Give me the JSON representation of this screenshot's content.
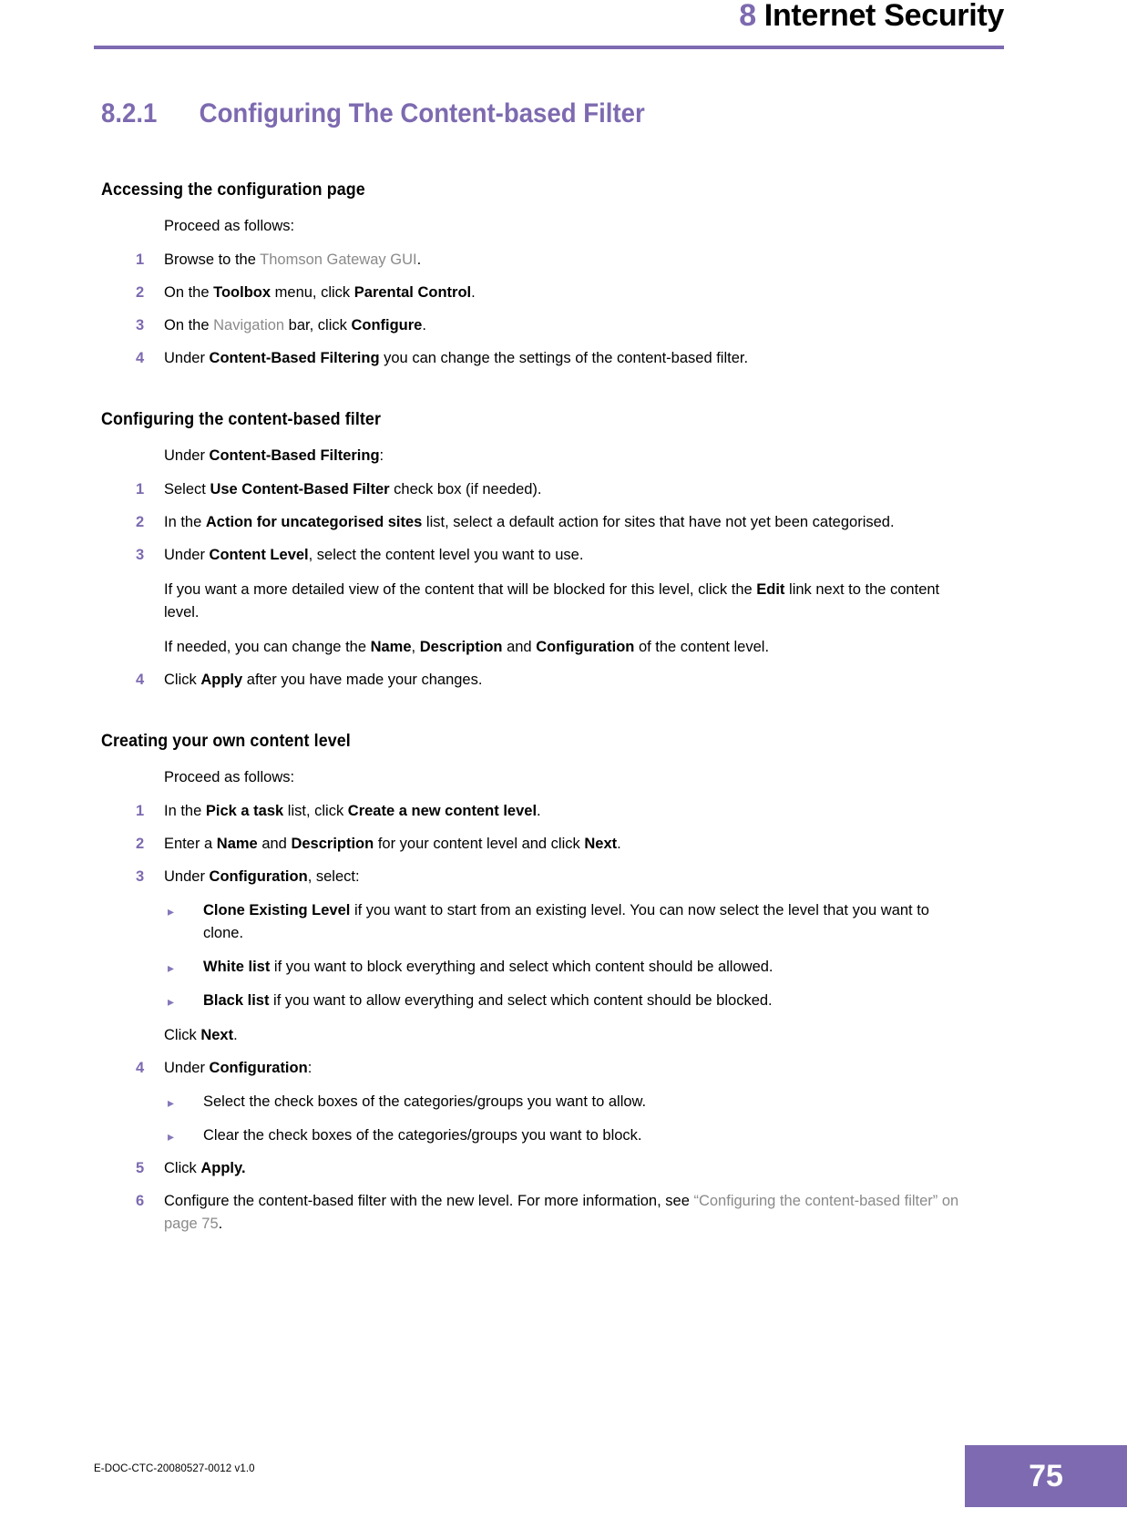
{
  "header": {
    "chapter_number": "8",
    "chapter_title": "Internet Security",
    "rule_color": "#7d6ab0"
  },
  "section": {
    "number": "8.2.1",
    "title": "Configuring The Content-based Filter",
    "color": "#7d6ab0"
  },
  "blocks": [
    {
      "heading": "Accessing the configuration page",
      "intro": "Proceed as follows:",
      "items": [
        {
          "marker": "1",
          "text": "Browse to the Thomson Gateway GUI."
        },
        {
          "marker": "2",
          "text": "On the Toolbox menu, click Parental Control."
        },
        {
          "marker": "3",
          "text": "On the Navigation bar, click Configure."
        },
        {
          "marker": "4",
          "text": "Under Content-Based Filtering you can change the settings of the content-based filter."
        }
      ]
    },
    {
      "heading": "Configuring the content-based filter",
      "intro": "Under Content-Based Filtering:",
      "items": [
        {
          "marker": "1",
          "text": "Select Use Content-Based Filter check box (if needed)."
        },
        {
          "marker": "2",
          "text": "In the Action for uncategorised sites list, select a default action for sites that have not yet been categorised."
        },
        {
          "marker": "3",
          "text": "Under Content Level, select the content level you want to use.",
          "paragraphs": [
            "If you want a more detailed view of the content that will be blocked for this level, click the Edit link next to the content level.",
            "If needed, you can change the Name, Description and Configuration of the content level."
          ]
        },
        {
          "marker": "4",
          "text": "Click Apply after you have made your changes."
        }
      ]
    },
    {
      "heading": "Creating your own content level",
      "intro": "Proceed as follows:",
      "items": [
        {
          "marker": "1",
          "text": "In the Pick a task list, click Create a new content level."
        },
        {
          "marker": "2",
          "text": "Enter a Name and Description for your content level and click Next."
        },
        {
          "marker": "3",
          "text": "Under Configuration, select:",
          "bullets": [
            "Clone Existing Level if you want to start from an existing level. You can now select the level that you want to clone.",
            "White list if you want to block everything and select which content should be allowed.",
            "Black list if you want to allow everything and select which content should be blocked."
          ],
          "after": "Click Next."
        },
        {
          "marker": "4",
          "text": "Under Configuration:",
          "bullets": [
            "Select the check boxes of the categories/groups you want to allow.",
            "Clear the check boxes of the categories/groups you want to block."
          ]
        },
        {
          "marker": "5",
          "text": "Click Apply."
        },
        {
          "marker": "6",
          "text": "Configure the content-based filter with the new level. For more information, see “Configuring the content-based filter” on page 75."
        }
      ]
    }
  ],
  "bullet_glyph": "▸",
  "footer": {
    "doc_id": "E-DOC-CTC-20080527-0012 v1.0",
    "page_number": "75",
    "page_box_color": "#7d6ab0"
  },
  "b1_h": "Accessing the configuration page",
  "b1_intro": "Proceed as follows:",
  "b1_i1_n": "1",
  "b1_i1_a": "Browse to the ",
  "b1_i1_x": "Thomson Gateway GUI",
  "b1_i1_b": ".",
  "b1_i2_n": "2",
  "b1_i2_a": "On the ",
  "b1_i2_b": "Toolbox",
  "b1_i2_c": " menu, click ",
  "b1_i2_d": "Parental Control",
  "b1_i2_e": ".",
  "b1_i3_n": "3",
  "b1_i3_a": "On the ",
  "b1_i3_x": "Navigation",
  "b1_i3_b": " bar, click ",
  "b1_i3_c": "Configure",
  "b1_i3_d": ".",
  "b1_i4_n": "4",
  "b1_i4_a": "Under ",
  "b1_i4_b": "Content-Based Filtering",
  "b1_i4_c": " you can change the settings of the content-based filter.",
  "b2_h": "Configuring the content-based filter",
  "b2_intro_a": "Under ",
  "b2_intro_b": "Content-Based Filtering",
  "b2_intro_c": ":",
  "b2_i1_n": "1",
  "b2_i1_a": "Select ",
  "b2_i1_b": "Use Content-Based Filter",
  "b2_i1_c": " check box (if needed).",
  "b2_i2_n": "2",
  "b2_i2_a": "In the ",
  "b2_i2_b": "Action for uncategorised sites",
  "b2_i2_c": " list, select a default action for sites that have not yet been categorised.",
  "b2_i3_n": "3",
  "b2_i3_a": "Under ",
  "b2_i3_b": "Content Level",
  "b2_i3_c": ", select the content level you want to use.",
  "b2_i3_p1a": "If you want a more detailed view of the content that will be blocked for this level, click the ",
  "b2_i3_p1b": "Edit",
  "b2_i3_p1c": " link next to the content level.",
  "b2_i3_p2a": "If needed, you can change the ",
  "b2_i3_p2b": "Name",
  "b2_i3_p2c": ", ",
  "b2_i3_p2d": "Description",
  "b2_i3_p2e": " and ",
  "b2_i3_p2f": "Configuration",
  "b2_i3_p2g": " of the content level.",
  "b2_i4_n": "4",
  "b2_i4_a": "Click ",
  "b2_i4_b": "Apply",
  "b2_i4_c": " after you have made your changes.",
  "b3_h": "Creating your own content level",
  "b3_intro": "Proceed as follows:",
  "b3_i1_n": "1",
  "b3_i1_a": "In the ",
  "b3_i1_b": "Pick a task",
  "b3_i1_c": " list, click ",
  "b3_i1_d": "Create a new content level",
  "b3_i1_e": ".",
  "b3_i2_n": "2",
  "b3_i2_a": "Enter a ",
  "b3_i2_b": "Name",
  "b3_i2_c": " and ",
  "b3_i2_d": "Description",
  "b3_i2_e": " for your content level and click ",
  "b3_i2_f": "Next",
  "b3_i2_g": ".",
  "b3_i3_n": "3",
  "b3_i3_a": "Under ",
  "b3_i3_b": "Configuration",
  "b3_i3_c": ", select:",
  "b3_i3_bu1a": "Clone Existing Level",
  "b3_i3_bu1b": " if you want to start from an existing level. You can now select the level that you want to clone.",
  "b3_i3_bu2a": "White list",
  "b3_i3_bu2b": " if you want to block everything and select which content should be allowed.",
  "b3_i3_bu3a": "Black list",
  "b3_i3_bu3b": " if you want to allow everything and select which content should be blocked.",
  "b3_i3_after_a": "Click ",
  "b3_i3_after_b": "Next",
  "b3_i3_after_c": ".",
  "b3_i4_n": "4",
  "b3_i4_a": "Under ",
  "b3_i4_b": "Configuration",
  "b3_i4_c": ":",
  "b3_i4_bu1": "Select the check boxes of the categories/groups you want to allow.",
  "b3_i4_bu2": "Clear the check boxes of the categories/groups you want to block.",
  "b3_i5_n": "5",
  "b3_i5_a": "Click ",
  "b3_i5_b": "Apply.",
  "b3_i6_n": "6",
  "b3_i6_a": "Configure the content-based filter with the new level. For more information, see ",
  "b3_i6_x": "“Configuring the content-based filter” on page 75",
  "b3_i6_b": "."
}
